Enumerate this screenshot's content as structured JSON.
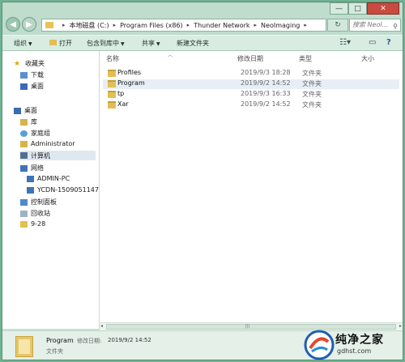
{
  "window": {
    "caption": {
      "minimize": "—",
      "maximize": "□",
      "close": "✕"
    }
  },
  "address": {
    "segments": [
      "本地磁盘 (C:)",
      "Program Files (x86)",
      "Thunder Network",
      "NeoImaging"
    ],
    "search_placeholder": "搜索 NeoI..."
  },
  "toolbar": {
    "organize": "组织",
    "open": "打开",
    "include_in_library": "包含到库中",
    "share": "共享",
    "new_folder": "新建文件夹"
  },
  "sidebar": {
    "favorites": "收藏夹",
    "downloads": "下载",
    "desktop_fav": "桌面",
    "desktop": "桌面",
    "library": "库",
    "homegroup": "家庭组",
    "administrator": "Administrator",
    "computer": "计算机",
    "network": "网络",
    "pc1": "ADMIN-PC",
    "pc2": "YCDN-1509051147",
    "control_panel": "控制面板",
    "recycle_bin": "回收站",
    "folder_928": "9-28"
  },
  "columns": {
    "name": "名称",
    "date": "修改日期",
    "type": "类型",
    "size": "大小"
  },
  "files": [
    {
      "name": "Profiles",
      "date": "2019/9/3 18:28",
      "type": "文件夹"
    },
    {
      "name": "Program",
      "date": "2019/9/2 14:52",
      "type": "文件夹"
    },
    {
      "name": "tp",
      "date": "2019/9/3 16:33",
      "type": "文件夹"
    },
    {
      "name": "Xar",
      "date": "2019/9/2 14:52",
      "type": "文件夹"
    }
  ],
  "details": {
    "name": "Program",
    "label": "修改日期:",
    "value": "2019/9/2 14:52",
    "type": "文件夹"
  },
  "watermark": {
    "text": "纯净之家",
    "url": "gdhst.com"
  },
  "colors": {
    "accent": "#c9e0d3",
    "close": "#c94b3f",
    "folder": "#e2bf55"
  }
}
